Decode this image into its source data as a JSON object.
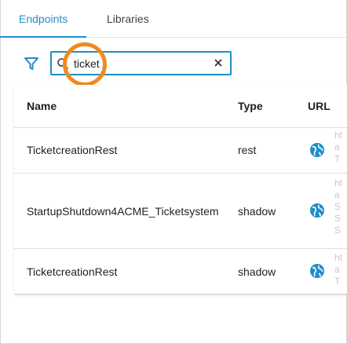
{
  "tabs": [
    {
      "label": "Endpoints",
      "active": true
    },
    {
      "label": "Libraries",
      "active": false
    }
  ],
  "search": {
    "value": "ticket",
    "placeholder": ""
  },
  "table": {
    "headers": {
      "name": "Name",
      "type": "Type",
      "url": "URL"
    },
    "rows": [
      {
        "name": "TicketcreationRest",
        "type": "rest",
        "url_fragments": [
          "ht",
          "a",
          "T"
        ]
      },
      {
        "name": "StartupShutdown4ACME_Ticketsystem",
        "type": "shadow",
        "url_fragments": [
          "ht",
          "a",
          "S",
          "S",
          "S"
        ]
      },
      {
        "name": "TicketcreationRest",
        "type": "shadow",
        "url_fragments": [
          "ht",
          "a",
          "T"
        ]
      }
    ]
  },
  "colors": {
    "accent": "#1e8fc8",
    "highlight": "#f08a1c",
    "globe": "#1e8fc8"
  },
  "icons": {
    "filter": "filter-icon",
    "search": "search-icon",
    "clear": "close-icon",
    "url": "globe-icon"
  }
}
